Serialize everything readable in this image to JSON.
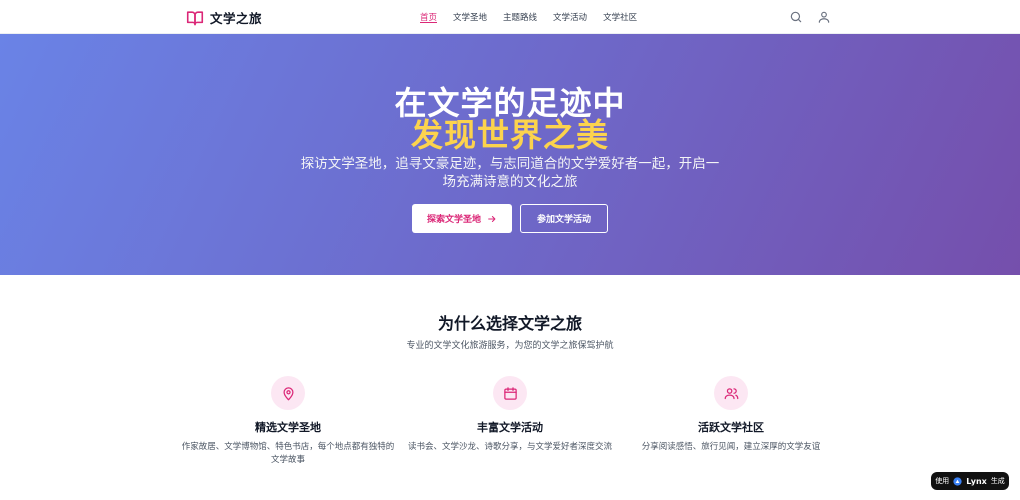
{
  "header": {
    "brand": "文学之旅",
    "nav": [
      {
        "label": "首页",
        "active": true
      },
      {
        "label": "文学圣地",
        "active": false
      },
      {
        "label": "主题路线",
        "active": false
      },
      {
        "label": "文学活动",
        "active": false
      },
      {
        "label": "文学社区",
        "active": false
      }
    ],
    "icons": {
      "logo": "book-open-icon",
      "search": "search-icon",
      "user": "user-icon"
    }
  },
  "hero": {
    "title_line1": "在文学的足迹中",
    "title_line2": "发现世界之美",
    "subtitle": "探访文学圣地，追寻文豪足迹，与志同道合的文学爱好者一起，开启一场充满诗意的文化之旅",
    "primary_button": "探索文学圣地",
    "secondary_button": "参加文学活动"
  },
  "features_section": {
    "title": "为什么选择文学之旅",
    "subtitle": "专业的文学文化旅游服务，为您的文学之旅保驾护航",
    "items": [
      {
        "icon": "map-pin-icon",
        "title": "精选文学圣地",
        "desc": "作家故居、文学博物馆、特色书店，每个地点都有独特的文学故事"
      },
      {
        "icon": "calendar-icon",
        "title": "丰富文学活动",
        "desc": "读书会、文学沙龙、诗歌分享，与文学爱好者深度交流"
      },
      {
        "icon": "users-icon",
        "title": "活跃文学社区",
        "desc": "分享阅读感悟、旅行见闻，建立深厚的文学友谊"
      }
    ]
  },
  "badge": {
    "prefix": "使用",
    "brand": "Lynx",
    "suffix": "生成"
  },
  "colors": {
    "accent": "#db2777",
    "highlight": "#fcd34d",
    "hero_start": "#6a83e6",
    "hero_end": "#754fac",
    "icon_bg": "#fce7f3"
  }
}
